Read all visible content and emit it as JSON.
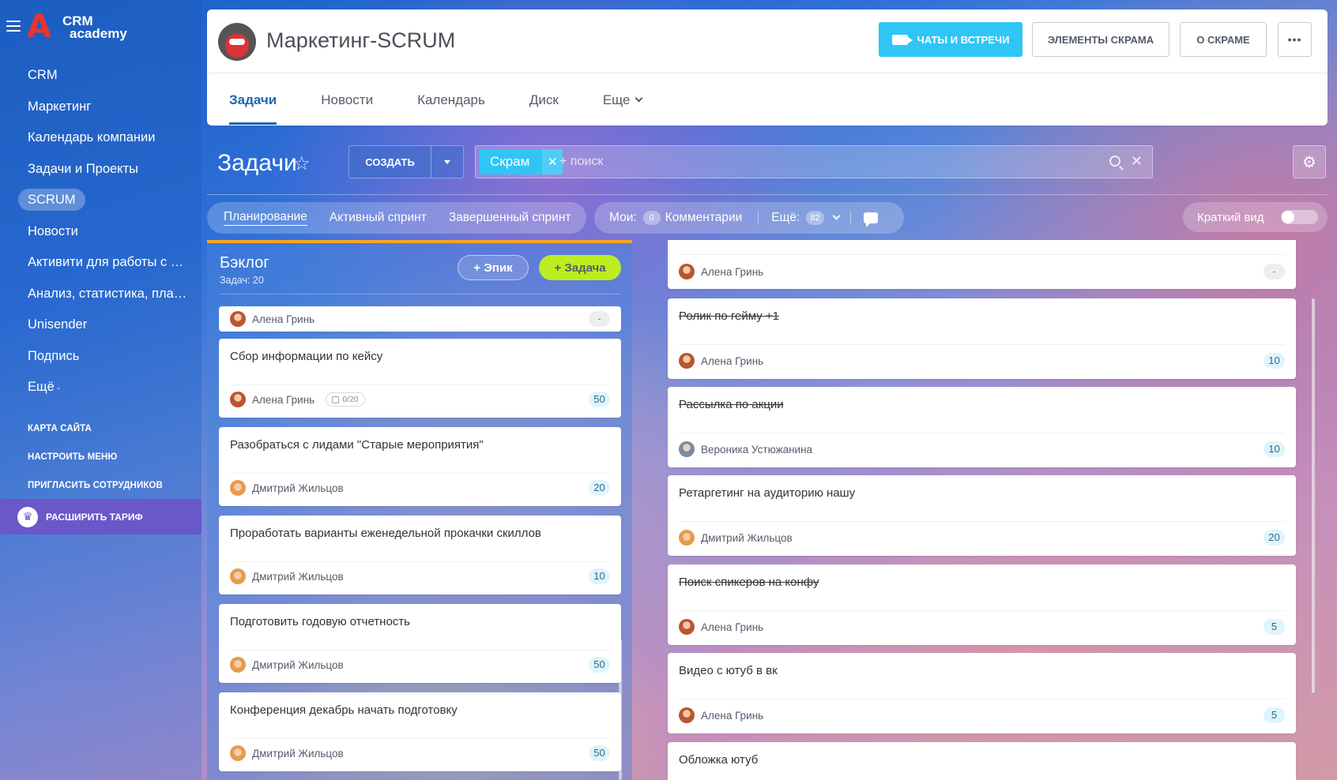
{
  "sidebar": {
    "logo": {
      "letter": "A",
      "line1": "CRM",
      "line2": "academy"
    },
    "items": [
      {
        "label": "CRM"
      },
      {
        "label": "Маркетинг"
      },
      {
        "label": "Календарь компании"
      },
      {
        "label": "Задачи и Проекты"
      },
      {
        "label": "SCRUM"
      },
      {
        "label": "Новости"
      },
      {
        "label": "Активити для работы с д..."
      },
      {
        "label": "Анализ, статистика, план..."
      },
      {
        "label": "Unisender"
      },
      {
        "label": "Подпись"
      },
      {
        "label": "Ещё"
      }
    ],
    "links": [
      "КАРТА САЙТА",
      "НАСТРОИТЬ МЕНЮ",
      "ПРИГЛАСИТЬ СОТРУДНИКОВ"
    ],
    "tariff": "РАСШИРИТЬ ТАРИФ",
    "tariff_icon": "crown-icon"
  },
  "header": {
    "project_title": "Маркетинг-SCRUM",
    "buttons": {
      "chats": "ЧАТЫ И ВСТРЕЧИ",
      "elements": "ЭЛЕМЕНТЫ СКРАМА",
      "about": "О СКРАМЕ",
      "more": "•••"
    },
    "tabs": [
      "Задачи",
      "Новости",
      "Календарь",
      "Диск",
      "Еще"
    ],
    "accent": "#2fc6f6"
  },
  "toolbar": {
    "title": "Задачи",
    "create": "СОЗДАТЬ",
    "filter_chip": "Скрам",
    "filter_placeholder": "+ поиск"
  },
  "views": {
    "tabs": [
      "Планирование",
      "Активный спринт",
      "Завершенный спринт"
    ],
    "mine_label": "Мои:",
    "mine_count": "0",
    "comments_label": "Комментарии",
    "more_label": "Ещё:",
    "more_count": "82",
    "compact_label": "Краткий вид"
  },
  "backlog": {
    "title": "Бэклог",
    "count": "Задач: 20",
    "epic_btn": "Эпик",
    "task_btn": "Задача",
    "cards": [
      {
        "title": "",
        "user": "Алена Гринь",
        "points": "-",
        "avatar": "f"
      },
      {
        "title": "Сбор информации по кейсу",
        "user": "Алена Гринь",
        "checklist": "0/20",
        "points": "50",
        "avatar": "f"
      },
      {
        "title": "Разобраться с лидами \"Старые мероприятия\"",
        "user": "Дмитрий Жильцов",
        "points": "20",
        "avatar": "m"
      },
      {
        "title": "Проработать варианты еженедельной прокачки скиллов",
        "user": "Дмитрий Жильцов",
        "points": "10",
        "avatar": "m"
      },
      {
        "title": "Подготовить годовую отчетность",
        "user": "Дмитрий Жильцов",
        "points": "50",
        "avatar": "m"
      },
      {
        "title": "Конференция декабрь начать подготовку",
        "user": "Дмитрий Жильцов",
        "points": "50",
        "avatar": "m"
      }
    ]
  },
  "sprint": {
    "cards": [
      {
        "title": "",
        "user": "Алена Гринь",
        "points": "-",
        "avatar": "f",
        "done": false
      },
      {
        "title": "Ролик по гейму +1",
        "user": "Алена Гринь",
        "points": "10",
        "avatar": "f",
        "done": true
      },
      {
        "title": "Рассылка по акции",
        "user": "Вероника Устюжанина",
        "points": "10",
        "avatar": "v",
        "done": true
      },
      {
        "title": "Ретаргетинг на аудиторию нашу",
        "user": "Дмитрий Жильцов",
        "points": "20",
        "avatar": "m",
        "done": false
      },
      {
        "title": "Поиск спикеров на конфу",
        "user": "Алена Гринь",
        "points": "5",
        "avatar": "f",
        "done": true
      },
      {
        "title": "Видео с ютуб в вк",
        "user": "Алена Гринь",
        "points": "5",
        "avatar": "f",
        "done": false
      },
      {
        "title": "Обложка ютуб",
        "user": "",
        "points": "",
        "avatar": "",
        "done": false
      }
    ]
  }
}
